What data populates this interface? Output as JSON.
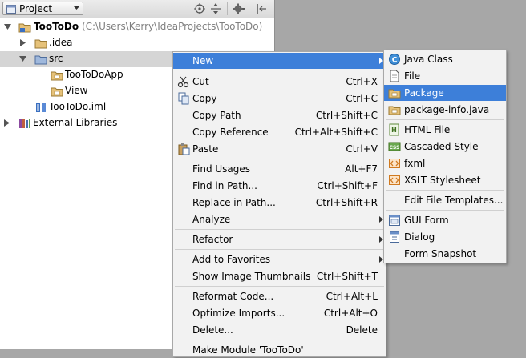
{
  "toolwindow": {
    "view_selector": "Project"
  },
  "tree": [
    {
      "label": "TooToDo",
      "path": " (C:\\Users\\Kerry\\IdeaProjects\\TooToDo)"
    },
    {
      "label": ".idea"
    },
    {
      "label": "src"
    },
    {
      "label": "TooToDoApp"
    },
    {
      "label": "View"
    },
    {
      "label": "TooToDo.iml"
    },
    {
      "label": "External Libraries"
    }
  ],
  "context_menu": {
    "items": [
      {
        "label": "New",
        "shortcut": ""
      },
      {
        "label": "Cut",
        "shortcut": "Ctrl+X"
      },
      {
        "label": "Copy",
        "shortcut": "Ctrl+C"
      },
      {
        "label": "Copy Path",
        "shortcut": "Ctrl+Shift+C"
      },
      {
        "label": "Copy Reference",
        "shortcut": "Ctrl+Alt+Shift+C"
      },
      {
        "label": "Paste",
        "shortcut": "Ctrl+V"
      },
      {
        "label": "Find Usages",
        "shortcut": "Alt+F7"
      },
      {
        "label": "Find in Path...",
        "shortcut": "Ctrl+Shift+F"
      },
      {
        "label": "Replace in Path...",
        "shortcut": "Ctrl+Shift+R"
      },
      {
        "label": "Analyze",
        "shortcut": ""
      },
      {
        "label": "Refactor",
        "shortcut": ""
      },
      {
        "label": "Add to Favorites",
        "shortcut": ""
      },
      {
        "label": "Show Image Thumbnails",
        "shortcut": "Ctrl+Shift+T"
      },
      {
        "label": "Reformat Code...",
        "shortcut": "Ctrl+Alt+L"
      },
      {
        "label": "Optimize Imports...",
        "shortcut": "Ctrl+Alt+O"
      },
      {
        "label": "Delete...",
        "shortcut": "Delete"
      },
      {
        "label": "Make Module 'TooToDo'",
        "shortcut": ""
      }
    ]
  },
  "new_submenu": {
    "items": [
      {
        "label": "Java Class",
        "icon": "java-class-icon"
      },
      {
        "label": "File",
        "icon": "file-icon"
      },
      {
        "label": "Package",
        "icon": "package-icon"
      },
      {
        "label": "package-info.java",
        "icon": "package-info-icon"
      },
      {
        "label": "HTML File",
        "icon": "html-file-icon"
      },
      {
        "label": "Cascaded Style",
        "icon": "css-file-icon"
      },
      {
        "label": "fxml",
        "icon": "fxml-file-icon"
      },
      {
        "label": "XSLT Stylesheet",
        "icon": "xslt-file-icon"
      },
      {
        "label": "Edit File Templates...",
        "icon": ""
      },
      {
        "label": "GUI Form",
        "icon": "gui-form-icon"
      },
      {
        "label": "Dialog",
        "icon": "dialog-icon"
      },
      {
        "label": "Form Snapshot",
        "icon": ""
      }
    ]
  },
  "colors": {
    "highlight": "#3d7fd9",
    "menu_bg": "#f2f2f2",
    "tree_selected": "#d5d5d5"
  }
}
